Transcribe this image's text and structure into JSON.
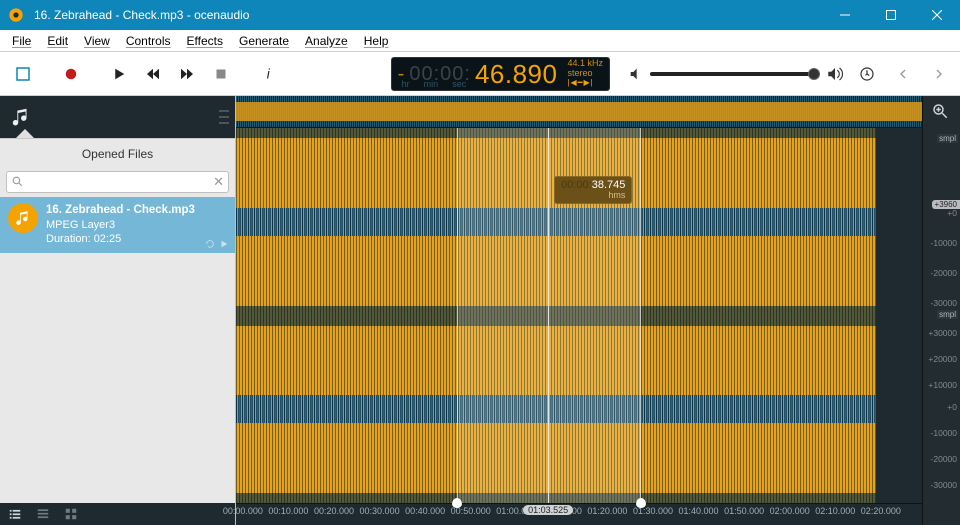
{
  "titlebar": {
    "title": "16. Zebrahead - Check.mp3 - ocenaudio"
  },
  "menu": {
    "file": "File",
    "edit": "Edit",
    "view": "View",
    "controls": "Controls",
    "effects": "Effects",
    "generate": "Generate",
    "analyze": "Analyze",
    "help": "Help"
  },
  "lcd": {
    "prefix_neg": "-",
    "prefix_grey": "00:00:",
    "main": "46.890",
    "unit_hr": "hr",
    "unit_min": "min",
    "unit_sec": "sec",
    "rate": "44.1 kHz",
    "channels": "stereo",
    "mode_icons": "|◀━▶|"
  },
  "sidebar": {
    "header": "Opened Files",
    "search_placeholder": "",
    "file": {
      "name": "16. Zebrahead - Check.mp3",
      "codec": "MPEG Layer3",
      "duration_label": "Duration: 02:25"
    }
  },
  "tooltip": {
    "grey": "00:00:",
    "value": "38.745",
    "units": "hms"
  },
  "ruler": {
    "smpl": "smpl",
    "ticks_top": [
      "+0",
      "-10000",
      "-20000",
      "-30000"
    ],
    "level_badge": "+3960",
    "ticks_bot": [
      "+0",
      "-10000",
      "-20000",
      "-30000",
      "+30000",
      "+20000",
      "+10000"
    ]
  },
  "timeline": {
    "ticks": [
      "00:00.000",
      "00:10.000",
      "00:20.000",
      "00:30.000",
      "00:40.000",
      "00:50.000",
      "01:00.000",
      "01:10.000",
      "01:20.000",
      "01:30.000",
      "01:40.000",
      "01:50.000",
      "02:00.000",
      "02:10.000",
      "02:20.000"
    ],
    "cursor_label": "01:03.525"
  },
  "selection": {
    "start_pct": 32.2,
    "end_pct": 59.0
  },
  "cursor": {
    "pct": 45.5
  },
  "overview": {
    "visible": true
  }
}
